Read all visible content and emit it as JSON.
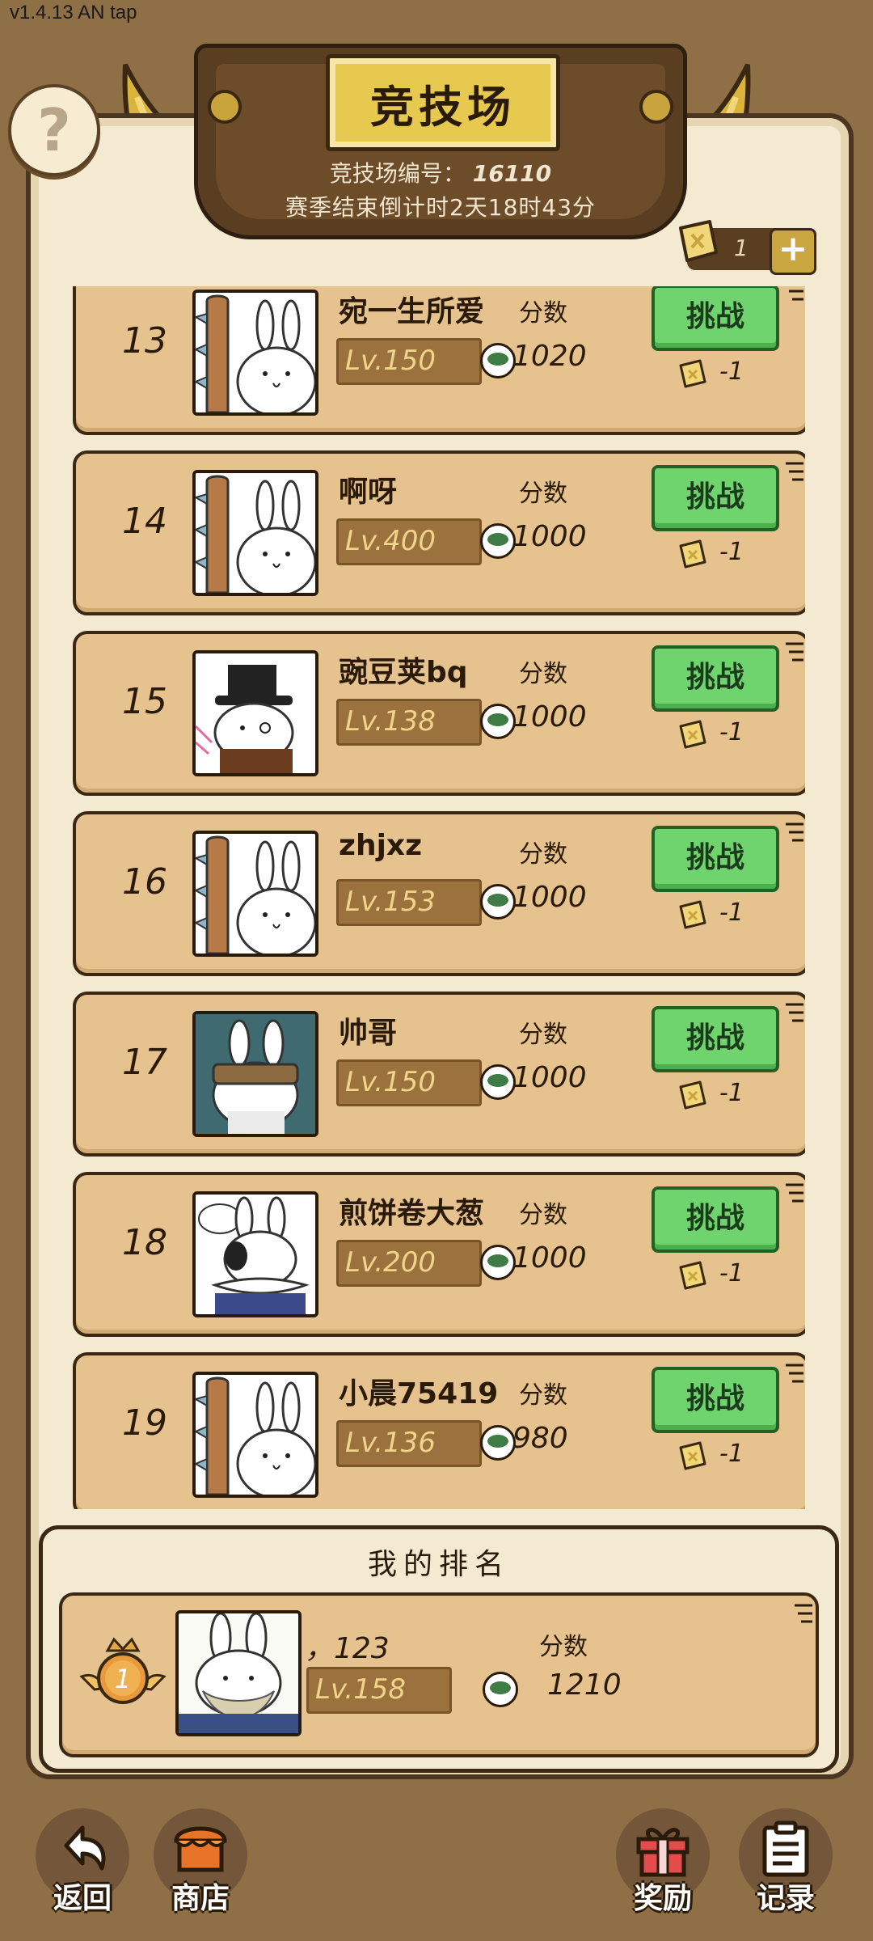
{
  "version": "v1.4.13 AN tap",
  "help": {
    "label": "?"
  },
  "header": {
    "title": "竞技场",
    "arena_id_label": "竞技场编号：",
    "arena_id": "16110",
    "countdown": "赛季结束倒计时2天18时43分"
  },
  "tickets": {
    "count": "1",
    "add_label": "+"
  },
  "list": {
    "score_label": "分数",
    "challenge_label": "挑战",
    "cost_label": "-1",
    "rows": [
      {
        "rank": "13",
        "name": "宛一生所爱",
        "level": "Lv.150",
        "score": "1020",
        "avatar": "club-bunny-avatar"
      },
      {
        "rank": "14",
        "name": "啊呀",
        "level": "Lv.400",
        "score": "1000",
        "avatar": "club-bunny-avatar"
      },
      {
        "rank": "15",
        "name": "豌豆荚bq",
        "level": "Lv.138",
        "score": "1000",
        "avatar": "tophat-bunny-avatar"
      },
      {
        "rank": "16",
        "name": "zhjxz",
        "level": "Lv.153",
        "score": "1000",
        "avatar": "club-bunny-avatar"
      },
      {
        "rank": "17",
        "name": "帅哥",
        "level": "Lv.150",
        "score": "1000",
        "avatar": "goggle-bunny-avatar"
      },
      {
        "rank": "18",
        "name": "煎饼卷大葱",
        "level": "Lv.200",
        "score": "1000",
        "avatar": "ruff-bunny-avatar"
      },
      {
        "rank": "19",
        "name": "小晨75419",
        "level": "Lv.136",
        "score": "980",
        "avatar": "club-bunny-avatar"
      }
    ]
  },
  "my_rank": {
    "title": "我的排名",
    "rank": "1",
    "name": "，123",
    "level": "Lv.158",
    "score_label": "分数",
    "score": "1210"
  },
  "nav": {
    "back": "返回",
    "shop": "商店",
    "reward": "奖励",
    "record": "记录"
  },
  "colors": {
    "background": "#8f6f45",
    "row": "#e6c28e",
    "challenge_button": "#6fd36e",
    "level_badge": "#9b723e"
  }
}
